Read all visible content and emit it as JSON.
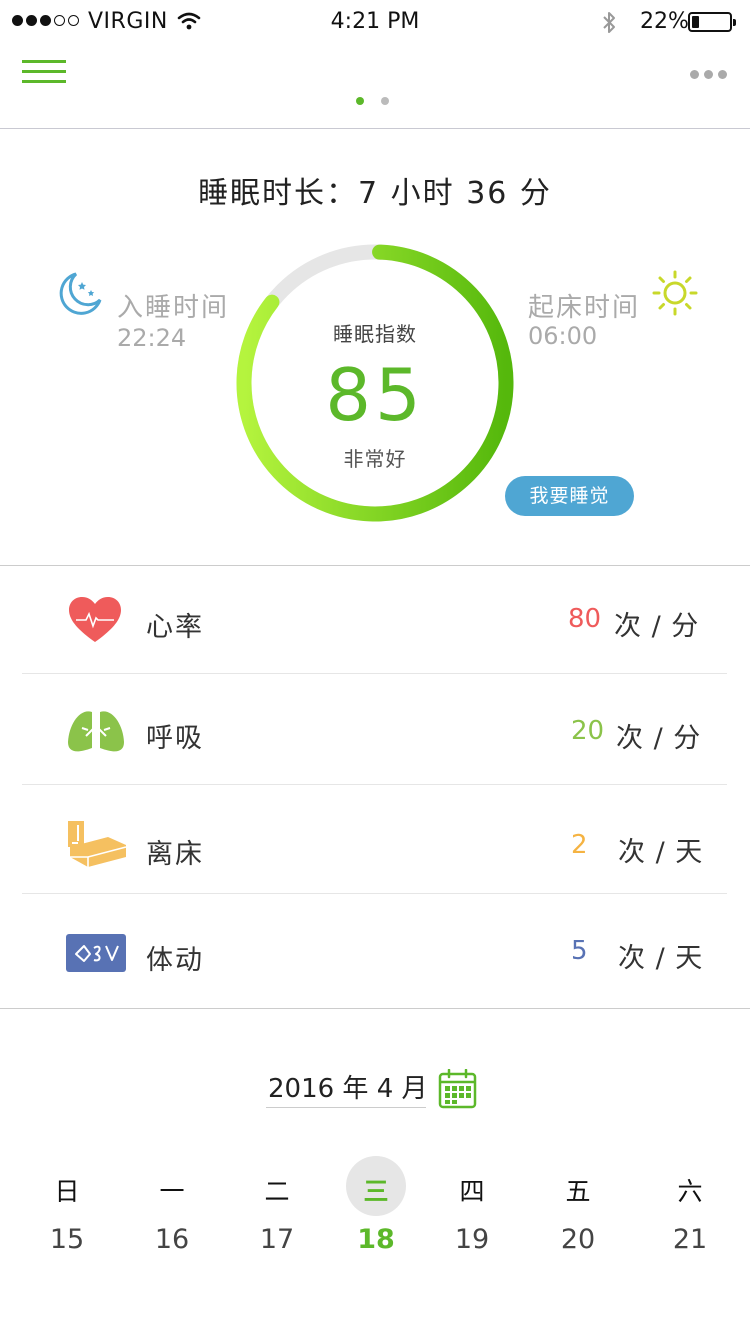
{
  "status": {
    "carrier": "VIRGIN",
    "time": "4:21 PM",
    "battery": "22%"
  },
  "summary": {
    "duration": "睡眠时长：7 小时 36 分",
    "bedtime_label": "入睡时间",
    "bedtime": "22:24",
    "wake_label": "起床时间",
    "wake_time": "06:00",
    "index_label": "睡眠指数",
    "index_value": "85",
    "index_rating": "非常好",
    "index_progress": 0.85,
    "sleep_button": "我要睡觉"
  },
  "metrics": [
    {
      "label": "心率",
      "value": "80",
      "unit": "次 / 分",
      "color": "#ef5b5b",
      "icon": "heart-icon"
    },
    {
      "label": "呼吸",
      "value": "20",
      "unit": "次 / 分",
      "color": "#8bc34a",
      "icon": "lungs-icon"
    },
    {
      "label": "离床",
      "value": "2",
      "unit": "次 / 天",
      "color": "#f5b342",
      "icon": "bed-icon"
    },
    {
      "label": "体动",
      "value": "5",
      "unit": "次 / 天",
      "color": "#5872b4",
      "icon": "movement-icon"
    }
  ],
  "calendar": {
    "month": "2016 年 4 月",
    "weekdays": [
      "日",
      "一",
      "二",
      "三",
      "四",
      "五",
      "六"
    ],
    "days": [
      "15",
      "16",
      "17",
      "18",
      "19",
      "20",
      "21"
    ],
    "selected_index": 3,
    "accent": "#5cb82a"
  }
}
